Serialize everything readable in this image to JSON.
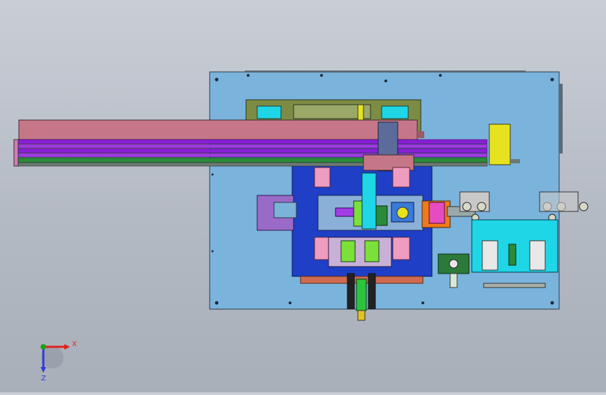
{
  "viewport": {
    "background_top": "#c9ced6",
    "background_bottom": "#a9afb9"
  },
  "triad": {
    "x_label": "X",
    "z_label": "Z",
    "x_color": "#e0201c",
    "y_color": "#1aa11a",
    "z_color": "#2a3cd8"
  },
  "colors": {
    "base_plate": "#7ab3dc",
    "table_blue": "#1e3fc6",
    "rail_pink": "#c67787",
    "rail_purple": "#8a1fd6",
    "rail_green": "#2b8a3a",
    "olive": "#7c8c45",
    "cyan": "#1fd6e6",
    "yellow": "#e6e21f",
    "orange": "#f07a1a",
    "pink": "#f09bc0",
    "lime": "#7be03a"
  },
  "icons": [
    "axis-triad-icon"
  ]
}
